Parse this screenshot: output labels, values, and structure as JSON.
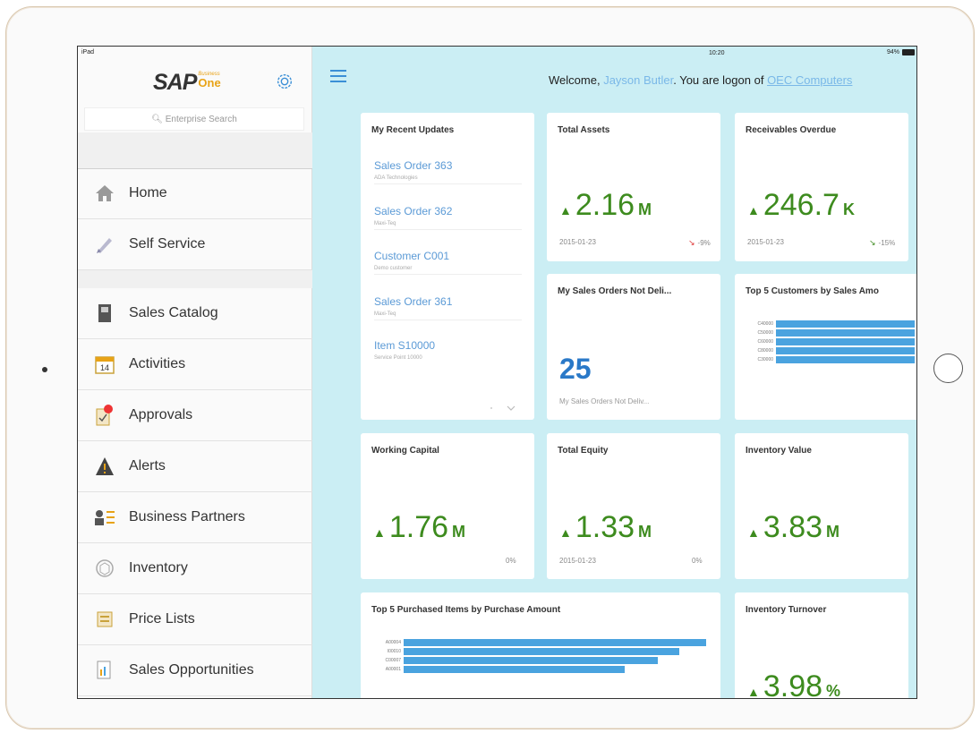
{
  "status": {
    "device": "iPad",
    "time": "10:20",
    "battery": "94%"
  },
  "logo": {
    "brand": "SAP",
    "sub1": "Business",
    "sub2": "One"
  },
  "search": {
    "placeholder": "Enterprise Search"
  },
  "nav": {
    "items": [
      {
        "label": "Home",
        "icon": "home-icon"
      },
      {
        "label": "Self Service",
        "icon": "self-service-icon"
      },
      {
        "label": "Sales Catalog",
        "icon": "catalog-icon"
      },
      {
        "label": "Activities",
        "icon": "calendar-icon",
        "badge": "14"
      },
      {
        "label": "Approvals",
        "icon": "approvals-icon"
      },
      {
        "label": "Alerts",
        "icon": "alert-icon"
      },
      {
        "label": "Business Partners",
        "icon": "partners-icon"
      },
      {
        "label": "Inventory",
        "icon": "inventory-icon"
      },
      {
        "label": "Price Lists",
        "icon": "price-list-icon"
      },
      {
        "label": "Sales Opportunities",
        "icon": "opportunities-icon"
      }
    ]
  },
  "header": {
    "welcome": "Welcome,",
    "user": "Jayson Butler",
    "logon": ". You are logon of",
    "company": "OEC Computers"
  },
  "recent": {
    "title": "My Recent Updates",
    "items": [
      {
        "title": "Sales Order 363",
        "sub": "ADA Technologies"
      },
      {
        "title": "Sales Order 362",
        "sub": "Maxi-Teq"
      },
      {
        "title": "Customer C001",
        "sub": "Demo customer"
      },
      {
        "title": "Sales Order 361",
        "sub": "Maxi-Teq"
      },
      {
        "title": "Item S10000",
        "sub": "Service Point 10000"
      }
    ]
  },
  "total_assets": {
    "title": "Total Assets",
    "value": "2.16",
    "unit": "M",
    "date": "2015-01-23",
    "pct": "-9%"
  },
  "receivables": {
    "title": "Receivables Overdue",
    "value": "246.7",
    "unit": "K",
    "date": "2015-01-23",
    "pct": "-15%"
  },
  "not_delivered": {
    "title": "My Sales Orders Not Deli...",
    "value": "25",
    "caption": "My Sales Orders Not Deliv..."
  },
  "top_customers": {
    "title": "Top 5 Customers by Sales Amo"
  },
  "working_capital": {
    "title": "Working Capital",
    "value": "1.76",
    "unit": "M",
    "pct": "0%"
  },
  "total_equity": {
    "title": "Total Equity",
    "value": "1.33",
    "unit": "M",
    "date": "2015-01-23",
    "pct": "0%"
  },
  "inventory_value": {
    "title": "Inventory Value",
    "value": "3.83",
    "unit": "M"
  },
  "top_purchased": {
    "title": "Top 5 Purchased Items by Purchase Amount"
  },
  "inventory_turnover": {
    "title": "Inventory Turnover",
    "value": "3.98",
    "unit": "%"
  },
  "chart_data": [
    {
      "type": "bar",
      "orientation": "horizontal",
      "title": "Top 5 Customers by Sales Amo",
      "categories": [
        "C40000",
        "C50000",
        "C60000",
        "C80000",
        "C30000"
      ],
      "values": [
        100,
        100,
        100,
        100,
        100
      ]
    },
    {
      "type": "bar",
      "orientation": "horizontal",
      "title": "Top 5 Purchased Items by Purchase Amount",
      "categories": [
        "A00004",
        "I00010",
        "C00007",
        "A00001"
      ],
      "values": [
        100,
        91,
        84,
        73
      ]
    }
  ]
}
